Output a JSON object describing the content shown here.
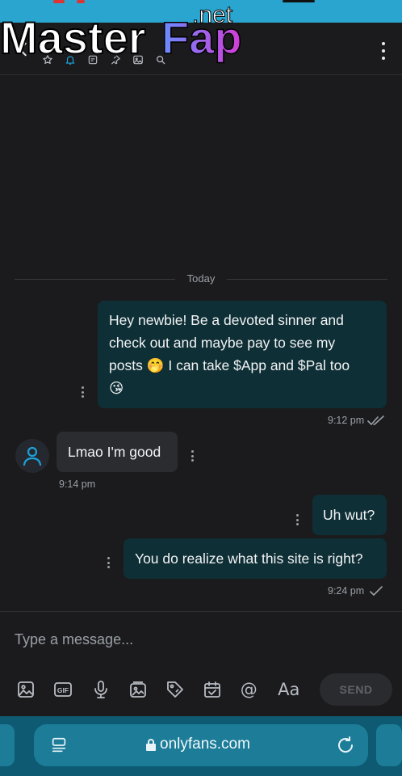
{
  "watermark": {
    "text_main": "Master",
    "text_accent": "Fap",
    "text_tld": ".net"
  },
  "header": {
    "icons": [
      "star-icon",
      "bell-icon",
      "note-icon",
      "pin-icon",
      "image-icon",
      "search-icon"
    ],
    "active_icon": "bell-icon"
  },
  "chat": {
    "day_label": "Today",
    "messages": [
      {
        "direction": "out",
        "lines": [
          "Hey newbie! Be a devoted sinner and",
          "check out and maybe pay to see my",
          "posts 🤭 I can take $App and $Pal too",
          "😘"
        ],
        "time": "9:12 pm",
        "status": "read"
      },
      {
        "direction": "in",
        "text": "Lmao I'm good",
        "time": "9:14 pm"
      },
      {
        "direction": "out",
        "text": "Uh wut?"
      },
      {
        "direction": "out",
        "text": "You do realize what this site is right?",
        "time": "9:24 pm",
        "status": "sent"
      }
    ]
  },
  "composer": {
    "placeholder": "Type a message...",
    "tools": [
      "image-icon",
      "gif-icon",
      "microphone-icon",
      "vault-icon",
      "price-tag-icon",
      "schedule-icon",
      "mention-icon",
      "text-format-icon"
    ],
    "gif_label": "GIF",
    "mention_label": "@",
    "format_label": "Aa",
    "send_label": "SEND"
  },
  "browser": {
    "url": "onlyfans.com"
  },
  "colors": {
    "background": "#1b1b1d",
    "accent": "#1da1d8",
    "outgoing_bubble": "#0f2f36",
    "incoming_bubble": "#2b2c30",
    "browser_bar": "#0d5a72"
  }
}
